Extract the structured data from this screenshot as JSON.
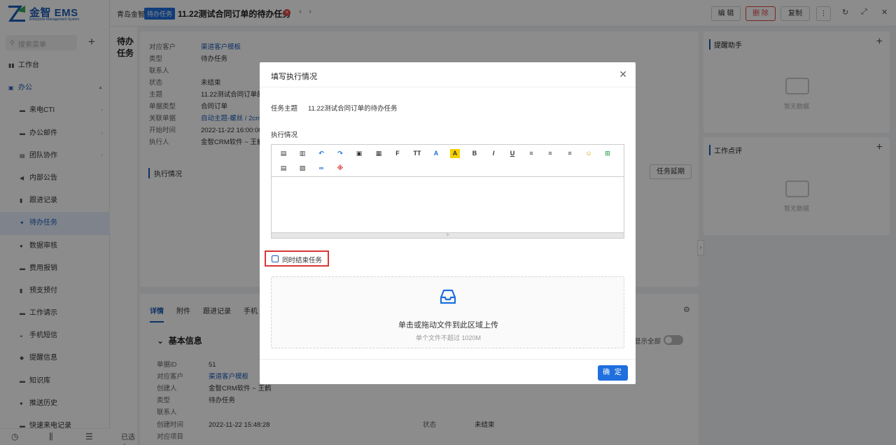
{
  "app": {
    "logo_text": "金智 EMS",
    "logo_sub": "Enterprise Management System",
    "company": "青岛金智测试"
  },
  "sidebar": {
    "search_placeholder": "搜索菜单",
    "items": [
      {
        "label": "工作台",
        "icon": "dashboard-icon"
      },
      {
        "label": "办公",
        "icon": "office-icon"
      },
      {
        "label": "来电CTI",
        "icon": "phone-icon"
      },
      {
        "label": "办公邮件",
        "icon": "mail-icon"
      },
      {
        "label": "团队协作",
        "icon": "team-icon"
      },
      {
        "label": "内部公告",
        "icon": "announcement-icon"
      },
      {
        "label": "跟进记录",
        "icon": "record-icon"
      },
      {
        "label": "待办任务",
        "icon": "pin-icon"
      },
      {
        "label": "数据审核",
        "icon": "audit-icon"
      },
      {
        "label": "费用报销",
        "icon": "expense-icon"
      },
      {
        "label": "预支预付",
        "icon": "advance-icon"
      },
      {
        "label": "工作请示",
        "icon": "request-icon"
      },
      {
        "label": "手机短信",
        "icon": "sms-icon"
      },
      {
        "label": "提醒信息",
        "icon": "bell-icon"
      },
      {
        "label": "知识库",
        "icon": "book-icon"
      },
      {
        "label": "推送历史",
        "icon": "history-icon"
      },
      {
        "label": "快速来电记录",
        "icon": "call-log-icon"
      }
    ]
  },
  "topbar": {
    "tag": "待办任务",
    "title": "11.22测试合同订单的待办任务",
    "edit": "编 辑",
    "delete": "删 除",
    "copy": "复制",
    "more": "⋮"
  },
  "list": {
    "title": "待办任务",
    "footer": "已选中"
  },
  "main": {
    "info": [
      {
        "label": "对应客户",
        "value": "渠道客户模板",
        "link": true
      },
      {
        "label": "类型",
        "value": "待办任务"
      },
      {
        "label": "联系人",
        "value": ""
      },
      {
        "label": "状态",
        "value": "未结束"
      },
      {
        "label": "主题",
        "value": "11.22测试合同订单的"
      },
      {
        "label": "单据类型",
        "value": "合同订单"
      },
      {
        "label": "关联单据",
        "value": "自动主题-螺丝 / 2cm",
        "link": true
      },
      {
        "label": "开始时间",
        "value": "2022-11-22 16:00:00"
      },
      {
        "label": "执行人",
        "value": "金智CRM软件 ~ 王鹤"
      }
    ],
    "exec_title": "执行情况",
    "btn_delay": "任务延期"
  },
  "detail": {
    "tabs": [
      "详情",
      "附件",
      "跟进记录",
      "手机"
    ],
    "section": "基本信息",
    "show_all": "显示全部",
    "rows": [
      {
        "label": "单据ID",
        "value": "51"
      },
      {
        "label": "对应客户",
        "value": "渠道客户模板",
        "link": true
      },
      {
        "label": "创建人",
        "value": "金智CRM软件 ~ 王鹤"
      },
      {
        "label": "类型",
        "value": "待办任务"
      },
      {
        "label": "联系人",
        "value": ""
      },
      {
        "label": "创建时间",
        "value": "2022-11-22 15:48:28"
      },
      {
        "label": "对应项目",
        "value": ""
      }
    ],
    "status_label": "状态",
    "status_value": "未结束"
  },
  "right": {
    "helper_title": "提醒助手",
    "review_title": "工作点评",
    "empty": "暂无数据"
  },
  "modal": {
    "title": "填写执行情况",
    "subject_label": "任务主题",
    "subject_value": "11.22测试合同订单的待办任务",
    "exec_label": "执行情况",
    "checkbox_label": "同时结束任务",
    "upload_main": "单击或拖动文件到此区域上传",
    "upload_sub": "单个文件不超过 1020M",
    "ok": "确 定",
    "resize_handle": "⊹",
    "toolbar": [
      {
        "icon": "source-icon",
        "glyph": "▤"
      },
      {
        "icon": "template-icon",
        "glyph": "▥"
      },
      {
        "icon": "undo-icon",
        "glyph": "↶"
      },
      {
        "icon": "redo-icon",
        "glyph": "↷"
      },
      {
        "icon": "paste-icon",
        "glyph": "▣"
      },
      {
        "icon": "paste-text-icon",
        "glyph": "▦"
      },
      {
        "icon": "font-family-icon",
        "glyph": "F"
      },
      {
        "icon": "font-size-icon",
        "glyph": "TT"
      },
      {
        "icon": "font-color-icon",
        "glyph": "A"
      },
      {
        "icon": "highlight-icon",
        "glyph": "A"
      },
      {
        "icon": "bold-icon",
        "glyph": "B"
      },
      {
        "icon": "italic-icon",
        "glyph": "I"
      },
      {
        "icon": "underline-icon",
        "glyph": "U"
      },
      {
        "icon": "align-left-icon",
        "glyph": "≡"
      },
      {
        "icon": "align-center-icon",
        "glyph": "≡"
      },
      {
        "icon": "align-right-icon",
        "glyph": "≡"
      },
      {
        "icon": "emoji-icon",
        "glyph": "☺"
      },
      {
        "icon": "insert-row-icon",
        "glyph": "⊞"
      },
      {
        "icon": "table-icon",
        "glyph": "▤"
      },
      {
        "icon": "image-icon",
        "glyph": "▨"
      },
      {
        "icon": "link-icon",
        "glyph": "∞"
      },
      {
        "icon": "special-char-icon",
        "glyph": "※"
      }
    ]
  },
  "colors": {
    "primary": "#1f6fde",
    "danger": "#e04646",
    "highlight_border": "#d93535"
  }
}
